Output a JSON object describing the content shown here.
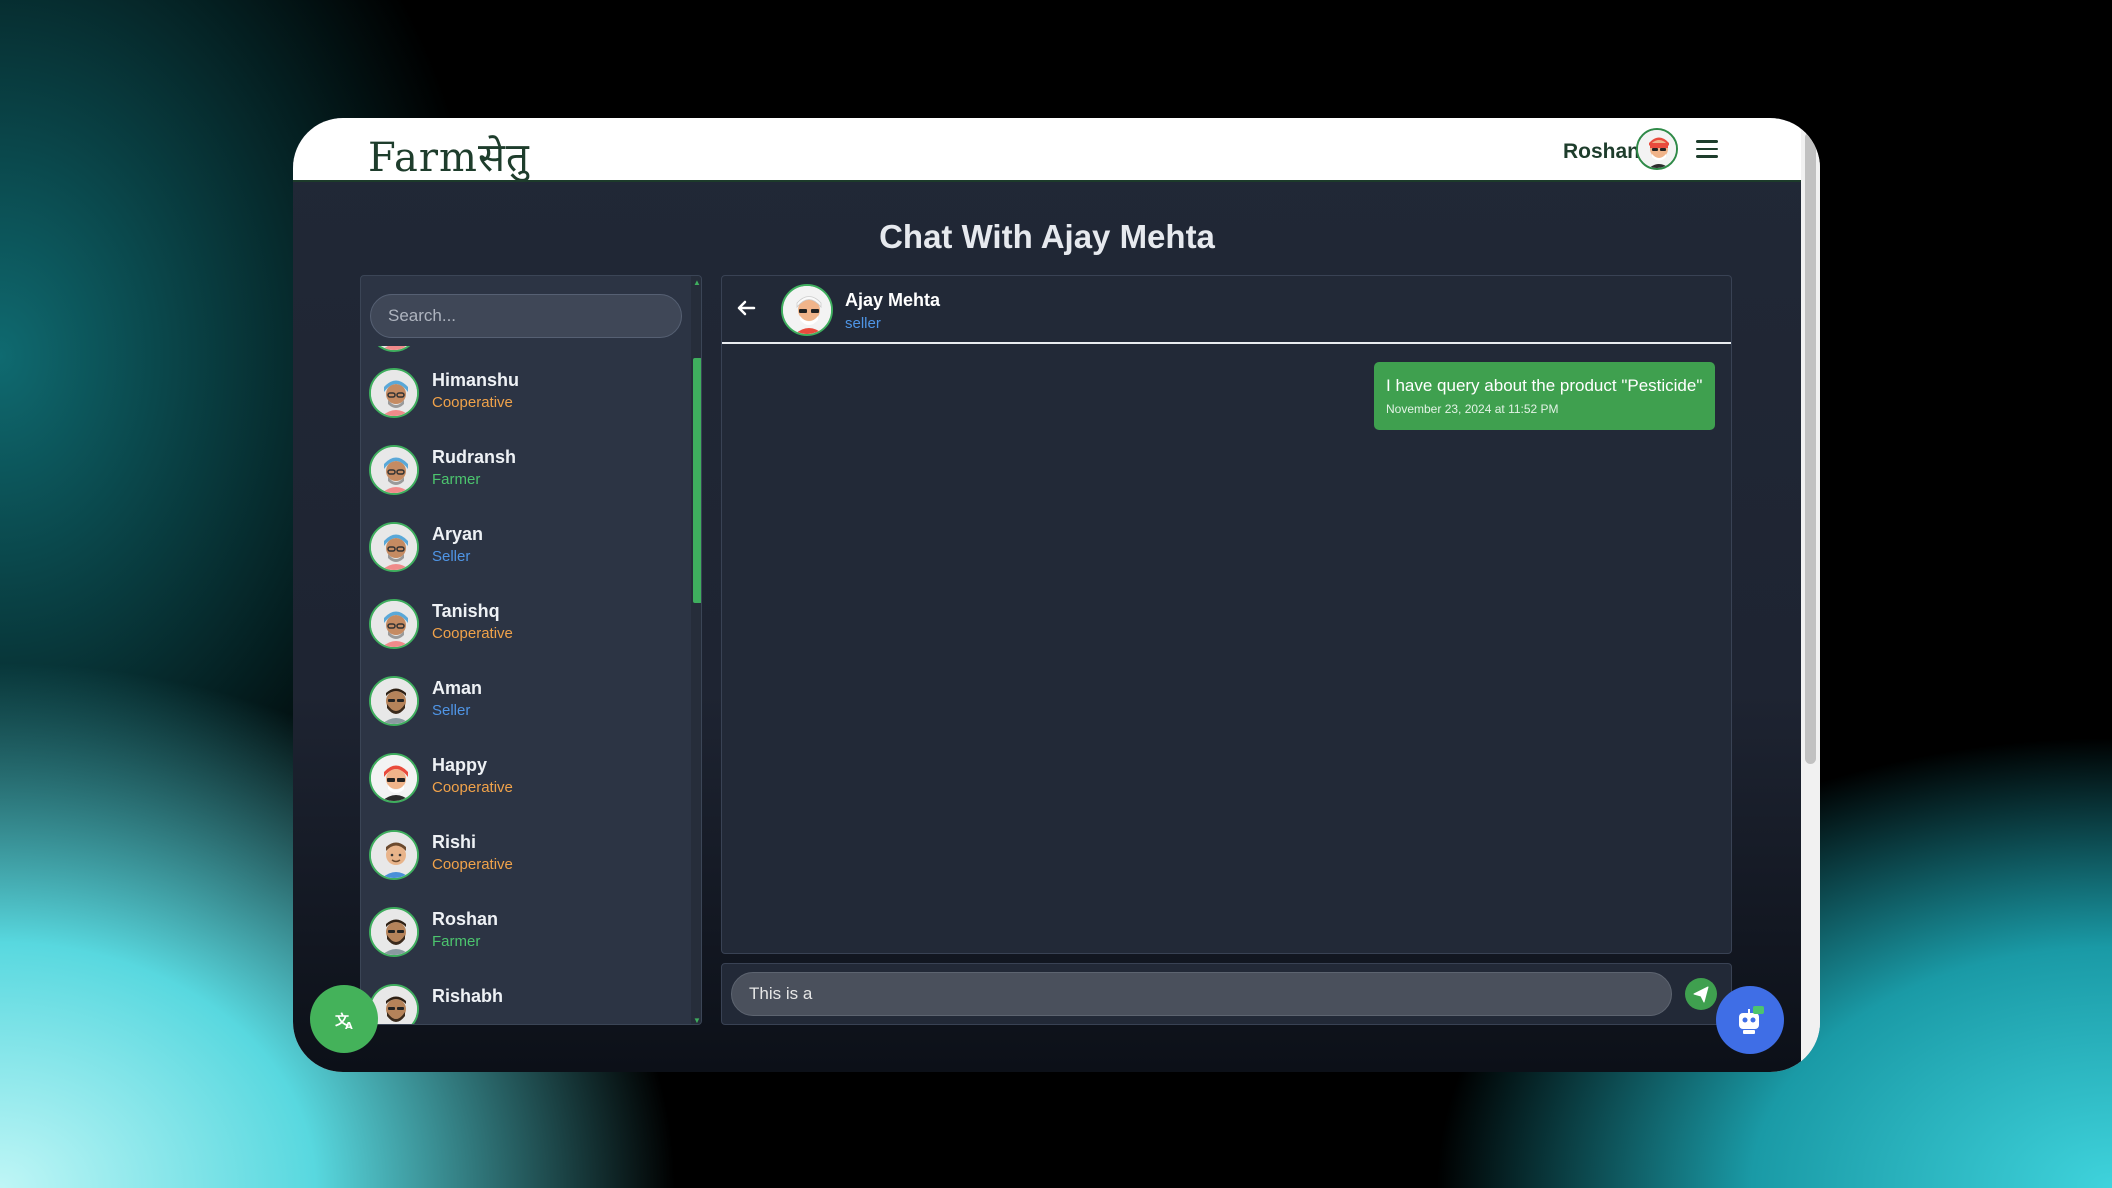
{
  "navbar": {
    "logo": "Farmसेतु",
    "user_name": "Roshan"
  },
  "page": {
    "title": "Chat With Ajay Mehta"
  },
  "sidebar": {
    "search_placeholder": "Search...",
    "contacts": [
      {
        "name": "Himanshu",
        "role": "Cooperative",
        "avatar": "turban-blue-avatar"
      },
      {
        "name": "Rudransh",
        "role": "Farmer",
        "avatar": "turban-blue-avatar"
      },
      {
        "name": "Aryan",
        "role": "Seller",
        "avatar": "turban-blue-avatar"
      },
      {
        "name": "Tanishq",
        "role": "Cooperative",
        "avatar": "turban-blue-avatar"
      },
      {
        "name": "Aman",
        "role": "Seller",
        "avatar": "bearded-man-avatar"
      },
      {
        "name": "Happy",
        "role": "Cooperative",
        "avatar": "turban-red-avatar"
      },
      {
        "name": "Rishi",
        "role": "Cooperative",
        "avatar": "young-man-avatar"
      },
      {
        "name": "Roshan",
        "role": "Farmer",
        "avatar": "bearded-man-avatar"
      },
      {
        "name": "Rishabh",
        "role": "",
        "avatar": "bearded-man-avatar"
      }
    ]
  },
  "chat": {
    "contact_name": "Ajay Mehta",
    "contact_role": "seller",
    "messages": [
      {
        "text": "I have query about the product \"Pesticide\"",
        "time": "November 23, 2024 at 11:52 PM",
        "sender": "me"
      }
    ],
    "composer_value": "This is a"
  },
  "colors": {
    "accent_green": "#3fa04f",
    "cooperative": "#f0a24a",
    "farmer": "#4cc46e",
    "seller": "#4f95e6",
    "bot_button": "#3f6ee6"
  },
  "icons": {
    "translate": "translate-icon",
    "bot": "chatbot-icon",
    "send": "send-icon",
    "back": "arrow-left-icon",
    "menu": "hamburger-menu-icon"
  }
}
